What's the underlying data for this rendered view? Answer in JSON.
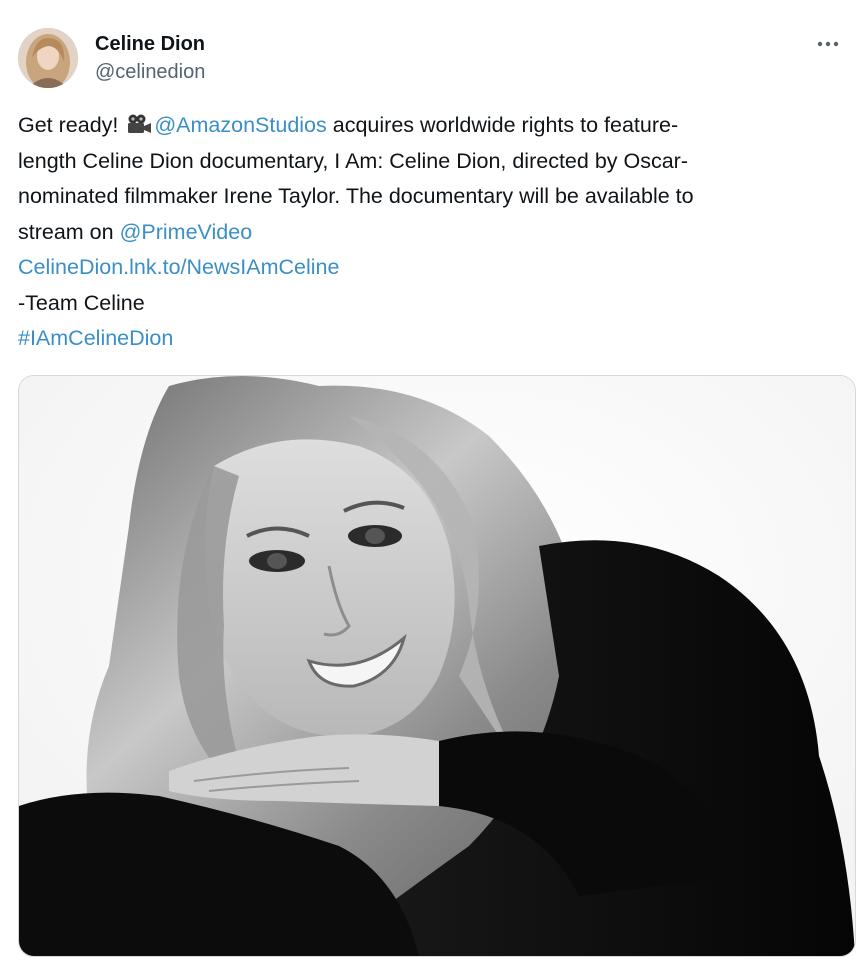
{
  "author": {
    "display_name": "Celine Dion",
    "handle": "@celinedion",
    "avatar_icon": "avatar-photo"
  },
  "more_icon": "more-horizontal-icon",
  "tweet": {
    "line1_pre": "Get ready! ",
    "camera_icon": "movie-camera-icon",
    "line1_mention": "@AmazonStudios",
    "line1_post": " acquires worldwide rights to feature-",
    "line2": "length Celine Dion documentary, I Am: Celine Dion, directed by Oscar-",
    "line3": "nominated filmmaker Irene Taylor. The documentary will be available to",
    "line4_pre": "stream on ",
    "line4_mention": "@PrimeVideo",
    "link": "CelineDion.lnk.to/NewsIAmCeline",
    "signature": "-Team Celine",
    "hashtag": "#IAmCelineDion"
  },
  "colors": {
    "link": "#3a8fc6",
    "text": "#0f1419",
    "secondary": "#536471",
    "border": "#cfd9de"
  },
  "media": {
    "description_icon": "black-and-white-portrait-photo"
  }
}
